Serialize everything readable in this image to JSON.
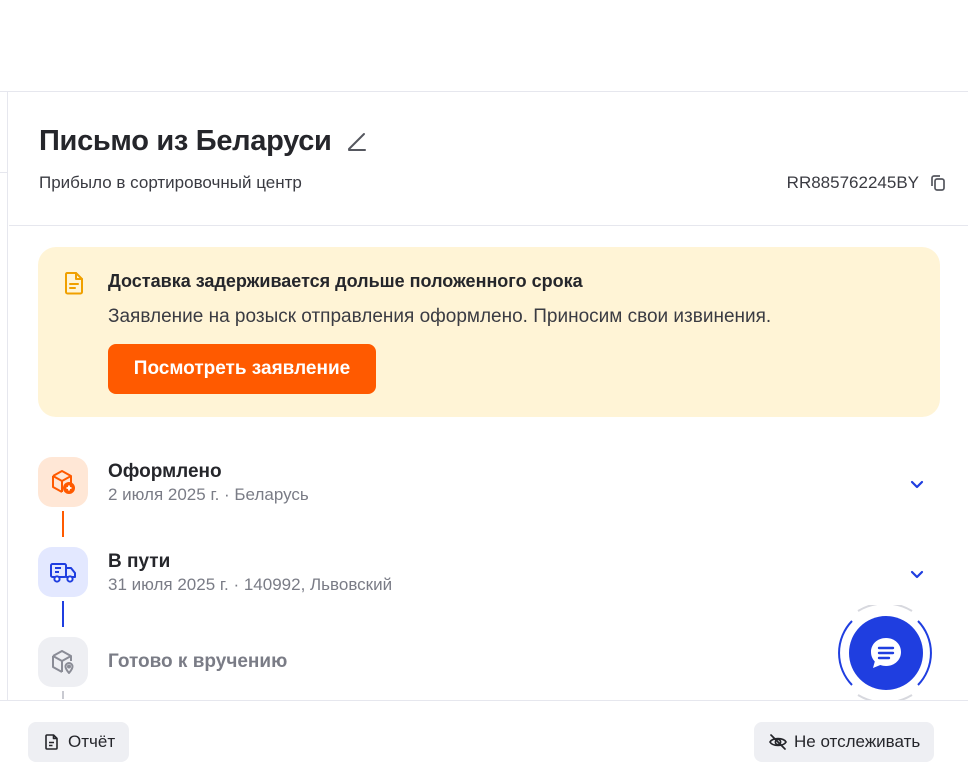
{
  "parcel": {
    "title": "Письмо из Беларуси",
    "status": "Прибыло в сортировочный центр",
    "tracking_number": "RR885762245BY"
  },
  "alert": {
    "title": "Доставка задерживается дольше положенного срока",
    "text": "Заявление на розыск отправления оформлено. Приносим свои извинения.",
    "button_label": "Посмотреть заявление"
  },
  "timeline": [
    {
      "title": "Оформлено",
      "subtitle": "2 июля 2025 г. · Беларусь",
      "icon": "box-plus-icon",
      "state": "done"
    },
    {
      "title": "В пути",
      "subtitle": "31 июля 2025 г. · 140992, Львовский",
      "icon": "truck-icon",
      "state": "current"
    },
    {
      "title": "Готово к вручению",
      "subtitle": "",
      "icon": "box-pin-icon",
      "state": "pending"
    }
  ],
  "footer": {
    "report_label": "Отчёт",
    "untrack_label": "Не отслеживать"
  },
  "colors": {
    "accent_orange": "#ff5a00",
    "accent_blue": "#1f3ee0",
    "alert_bg": "#fff4d6"
  }
}
